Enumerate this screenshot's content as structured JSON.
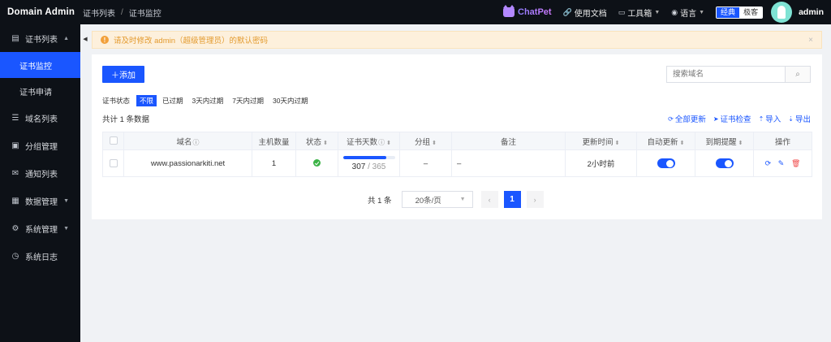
{
  "header": {
    "brand": "Domain Admin",
    "breadcrumb": [
      "证书列表",
      "证书监控"
    ],
    "chatpet": "ChatPet",
    "docs": "使用文档",
    "toolbox": "工具箱",
    "language": "语言",
    "theme": {
      "classic": "经典",
      "minimal": "极客"
    },
    "username": "admin"
  },
  "sidebar": {
    "items": [
      {
        "label": "证书列表",
        "expanded": true,
        "children": [
          {
            "label": "证书监控",
            "active": true
          },
          {
            "label": "证书申请",
            "active": false
          }
        ]
      },
      {
        "label": "域名列表"
      },
      {
        "label": "分组管理"
      },
      {
        "label": "通知列表"
      },
      {
        "label": "数据管理"
      },
      {
        "label": "系统管理"
      },
      {
        "label": "系统日志"
      }
    ]
  },
  "notice": {
    "text": "请及时修改 admin（超级管理员）的默认密码",
    "close": "×"
  },
  "toolbar": {
    "add_label": "添加",
    "add_icon": "＋",
    "search_placeholder": "搜索域名"
  },
  "filter": {
    "label": "证书状态",
    "options": [
      "不限",
      "已过期",
      "3天内过期",
      "7天内过期",
      "30天内过期"
    ],
    "selected": "不限"
  },
  "summary": {
    "total_text": "共计 1 条数据"
  },
  "actions": {
    "refresh_all": "全部更新",
    "check_cert": "证书检查",
    "import": "导入",
    "export": "导出"
  },
  "table": {
    "columns": [
      "域名",
      "主机数量",
      "状态",
      "证书天数",
      "分组",
      "备注",
      "更新时间",
      "自动更新",
      "到期提醒",
      "操作"
    ],
    "rows": [
      {
        "domain": "www.passionarkiti.net",
        "host_count": "1",
        "status": "ok",
        "days_left": "307",
        "days_total": "365",
        "progress": 0.84,
        "group": "–",
        "remark": "–",
        "updated": "2小时前",
        "auto_update": true,
        "expire_alert": true
      }
    ]
  },
  "pagination": {
    "total_text": "共 1 条",
    "page_size": "20条/页",
    "current_page": "1"
  },
  "colors": {
    "primary": "#1a56ff",
    "sidebar_bg": "#0d1117",
    "warning": "#e39a2e",
    "success": "#3bb346",
    "danger": "#f04a4a"
  }
}
